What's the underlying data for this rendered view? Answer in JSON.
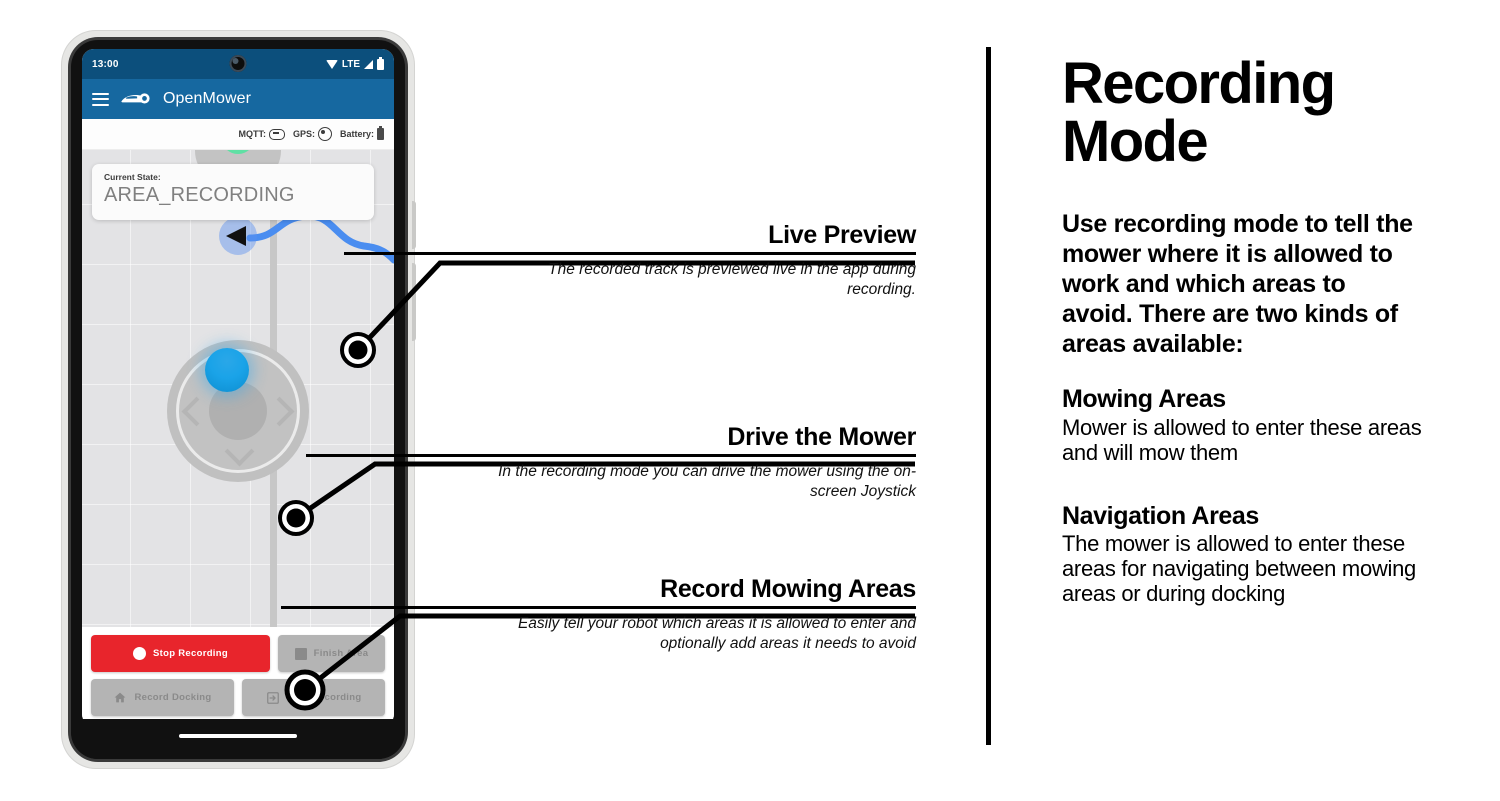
{
  "phone": {
    "status_bar": {
      "clock": "13:00",
      "network_label": "LTE",
      "icons": [
        "wifi-icon",
        "signal-icon",
        "battery-icon"
      ]
    },
    "app_bar": {
      "menu_icon": "hamburger-menu-icon",
      "logo_icon": "openmower-logo-icon",
      "title": "OpenMower"
    },
    "status_strip": {
      "mqtt_label": "MQTT:",
      "mqtt_icon": "link-icon",
      "gps_label": "GPS:",
      "gps_icon": "gps-target-icon",
      "battery_label": "Battery:",
      "battery_icon": "battery-icon"
    },
    "state_card": {
      "label": "Current State:",
      "value": "AREA_RECORDING"
    },
    "map": {
      "robot_marker": "robot-heading-arrow",
      "track_color": "#4a8df0",
      "background_color": "#e3e3e5"
    },
    "joystick": {
      "knob_color": "#1aa3e8",
      "left_chevron": "chevron-left-icon",
      "right_chevron": "chevron-right-icon",
      "down_chevron": "chevron-down-icon"
    },
    "buttons": [
      {
        "label": "Stop Recording",
        "icon": "record-dot-icon",
        "style": "danger"
      },
      {
        "label": "Finish Area",
        "icon": "stop-square-icon",
        "style": "muted"
      },
      {
        "label": "Record Docking",
        "icon": "home-icon",
        "style": "muted"
      },
      {
        "label": "Area Recording",
        "icon": "enter-area-icon",
        "style": "muted"
      }
    ]
  },
  "callouts": [
    {
      "title": "Live Preview",
      "body": "The recorded track is previewed live in the app during recording."
    },
    {
      "title": "Drive the Mower",
      "body": "In the recording mode you can drive the mower using the on-screen Joystick"
    },
    {
      "title": "Record Mowing Areas",
      "body": "Easily tell your robot which areas it is allowed to enter and optionally add areas it needs to avoid"
    }
  ],
  "panel": {
    "title_line1": "Recording",
    "title_line2": "Mode",
    "intro": "Use recording mode to tell the mower where it is allowed to work and which areas to avoid. There are two kinds of areas available:",
    "sections": [
      {
        "heading": "Mowing Areas",
        "body": "Mower is allowed to enter these areas and will mow them"
      },
      {
        "heading": "Navigation Areas",
        "body": "The mower is allowed to enter these areas for navigating between mowing areas or during docking"
      }
    ]
  }
}
